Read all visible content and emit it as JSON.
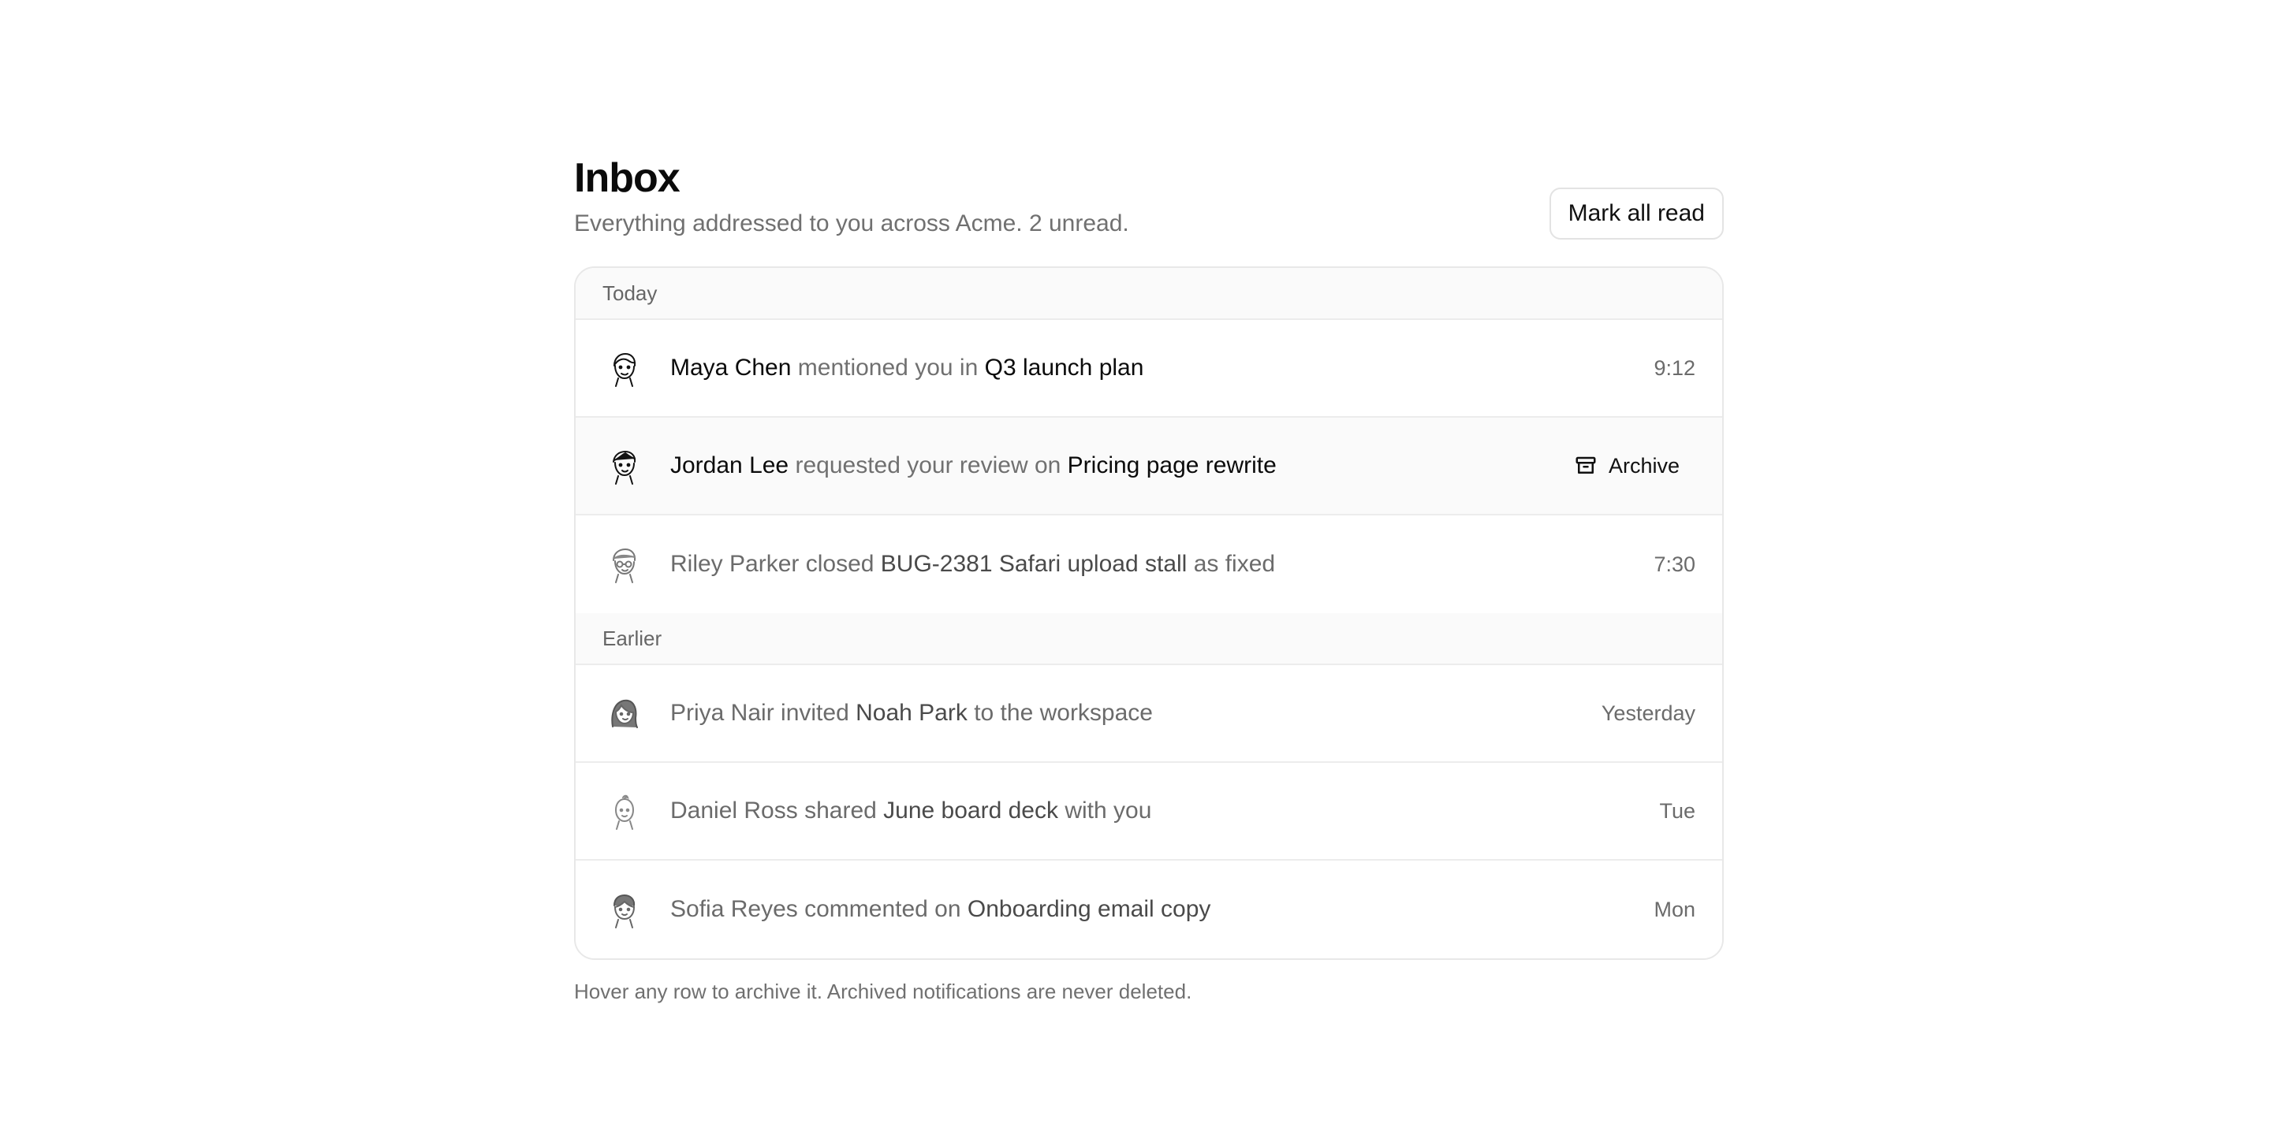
{
  "header": {
    "title": "Inbox",
    "subtitle": "Everything addressed to you across Acme. 2 unread.",
    "mark_all_read_label": "Mark all read"
  },
  "groups": [
    {
      "label": "Today",
      "items": [
        {
          "actor": "Maya Chen",
          "verb": "mentioned you in",
          "target": "Q3 launch plan",
          "suffix": "",
          "time": "9:12",
          "unread": true,
          "avatar_icon": "person-avatar-icon"
        },
        {
          "actor": "Jordan Lee",
          "verb": "requested your review on",
          "target": "Pricing page rewrite",
          "suffix": "",
          "time": "",
          "unread": true,
          "hovered": true,
          "action_label": "Archive",
          "action_icon": "archive-icon",
          "avatar_icon": "person-avatar-icon"
        },
        {
          "actor": "Riley Parker",
          "verb": "closed",
          "target": "BUG-2381 Safari upload stall",
          "suffix": "as fixed",
          "time": "7:30",
          "unread": false,
          "avatar_icon": "person-avatar-icon"
        }
      ]
    },
    {
      "label": "Earlier",
      "items": [
        {
          "actor": "Priya Nair",
          "verb": "invited",
          "target": "Noah Park",
          "suffix": "to the workspace",
          "time": "Yesterday",
          "unread": false,
          "avatar_icon": "person-avatar-icon"
        },
        {
          "actor": "Daniel Ross",
          "verb": "shared",
          "target": "June board deck",
          "suffix": "with you",
          "time": "Tue",
          "unread": false,
          "avatar_icon": "person-avatar-icon"
        },
        {
          "actor": "Sofia Reyes",
          "verb": "commented on",
          "target": "Onboarding email copy",
          "suffix": "",
          "time": "Mon",
          "unread": false,
          "avatar_icon": "person-avatar-icon"
        }
      ]
    }
  ],
  "footnote": "Hover any row to archive it. Archived notifications are never deleted.",
  "colors": {
    "text_primary": "#0b0b0b",
    "text_muted": "#707070",
    "border": "#e8e8e8",
    "section_bg": "#fafafa"
  }
}
